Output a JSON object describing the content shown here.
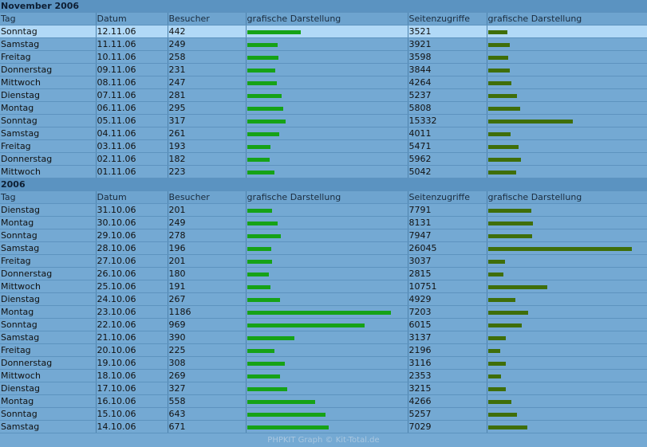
{
  "colors": {
    "visit_bar": "#16a217",
    "view_bar": "#3f6e0a",
    "highlight": "#b1d9f7"
  },
  "headers": [
    "Tag",
    "Datum",
    "Besucher",
    "grafische Darstellung",
    "Seitenzugriffe",
    "grafische Darstellung"
  ],
  "footer": "PHPKIT Graph © Kit-Total.de",
  "sections": [
    {
      "title": "November 2006",
      "rows": [
        {
          "day": "Sonntag",
          "date": "12.11.06",
          "visits": 442,
          "views": 3521,
          "highlight": true
        },
        {
          "day": "Samstag",
          "date": "11.11.06",
          "visits": 249,
          "views": 3921
        },
        {
          "day": "Freitag",
          "date": "10.11.06",
          "visits": 258,
          "views": 3598
        },
        {
          "day": "Donnerstag",
          "date": "09.11.06",
          "visits": 231,
          "views": 3844
        },
        {
          "day": "Mittwoch",
          "date": "08.11.06",
          "visits": 247,
          "views": 4264
        },
        {
          "day": "Dienstag",
          "date": "07.11.06",
          "visits": 281,
          "views": 5237
        },
        {
          "day": "Montag",
          "date": "06.11.06",
          "visits": 295,
          "views": 5808
        },
        {
          "day": "Sonntag",
          "date": "05.11.06",
          "visits": 317,
          "views": 15332
        },
        {
          "day": "Samstag",
          "date": "04.11.06",
          "visits": 261,
          "views": 4011
        },
        {
          "day": "Freitag",
          "date": "03.11.06",
          "visits": 193,
          "views": 5471
        },
        {
          "day": "Donnerstag",
          "date": "02.11.06",
          "visits": 182,
          "views": 5962
        },
        {
          "day": "Mittwoch",
          "date": "01.11.06",
          "visits": 223,
          "views": 5042
        }
      ]
    },
    {
      "title": "2006",
      "rows": [
        {
          "day": "Dienstag",
          "date": "31.10.06",
          "visits": 201,
          "views": 7791
        },
        {
          "day": "Montag",
          "date": "30.10.06",
          "visits": 249,
          "views": 8131
        },
        {
          "day": "Sonntag",
          "date": "29.10.06",
          "visits": 278,
          "views": 7947
        },
        {
          "day": "Samstag",
          "date": "28.10.06",
          "visits": 196,
          "views": 26045
        },
        {
          "day": "Freitag",
          "date": "27.10.06",
          "visits": 201,
          "views": 3037
        },
        {
          "day": "Donnerstag",
          "date": "26.10.06",
          "visits": 180,
          "views": 2815
        },
        {
          "day": "Mittwoch",
          "date": "25.10.06",
          "visits": 191,
          "views": 10751
        },
        {
          "day": "Dienstag",
          "date": "24.10.06",
          "visits": 267,
          "views": 4929
        },
        {
          "day": "Montag",
          "date": "23.10.06",
          "visits": 1186,
          "views": 7203
        },
        {
          "day": "Sonntag",
          "date": "22.10.06",
          "visits": 969,
          "views": 6015
        },
        {
          "day": "Samstag",
          "date": "21.10.06",
          "visits": 390,
          "views": 3137
        },
        {
          "day": "Freitag",
          "date": "20.10.06",
          "visits": 225,
          "views": 2196
        },
        {
          "day": "Donnerstag",
          "date": "19.10.06",
          "visits": 308,
          "views": 3116
        },
        {
          "day": "Mittwoch",
          "date": "18.10.06",
          "visits": 269,
          "views": 2353
        },
        {
          "day": "Dienstag",
          "date": "17.10.06",
          "visits": 327,
          "views": 3215
        },
        {
          "day": "Montag",
          "date": "16.10.06",
          "visits": 558,
          "views": 4266
        },
        {
          "day": "Sonntag",
          "date": "15.10.06",
          "visits": 643,
          "views": 5257
        },
        {
          "day": "Samstag",
          "date": "14.10.06",
          "visits": 671,
          "views": 7029
        }
      ]
    }
  ]
}
